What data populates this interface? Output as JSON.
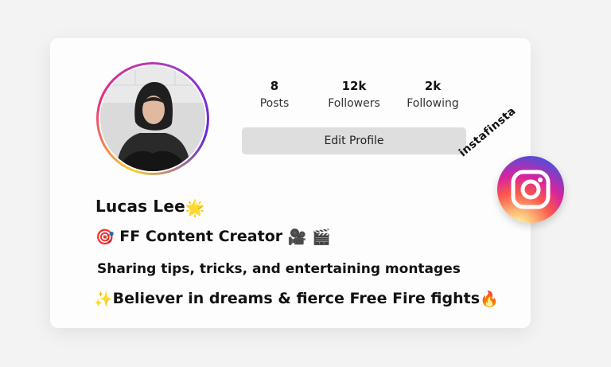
{
  "profile": {
    "name": "Lucas Lee",
    "name_emoji": "🌟",
    "stats": {
      "posts": {
        "value": "8",
        "label": "Posts"
      },
      "followers": {
        "value": "12k",
        "label": "Followers"
      },
      "following": {
        "value": "2k",
        "label": "Following"
      }
    },
    "edit_button": "Edit Profile",
    "bio": {
      "line1_prefix_emoji": "🎯",
      "line1_text": "FF Content Creator",
      "line1_suffix_emojis": "🎥 🎬",
      "line2_text": "Sharing tips, tricks, and entertaining montages",
      "line3_prefix_emoji": "✨",
      "line3_text": "Believer in dreams & fierce Free Fire fights",
      "line3_suffix_emoji": "🔥"
    }
  },
  "brand": {
    "text": "instafinsta",
    "logo_icon": "instagram-icon"
  },
  "colors": {
    "background": "#f3f3f3",
    "card": "#fdfdfd",
    "button": "#dedede",
    "ring_start": "#f9ce34",
    "ring_mid": "#ee2a7b",
    "ring_end": "#6228d7"
  }
}
